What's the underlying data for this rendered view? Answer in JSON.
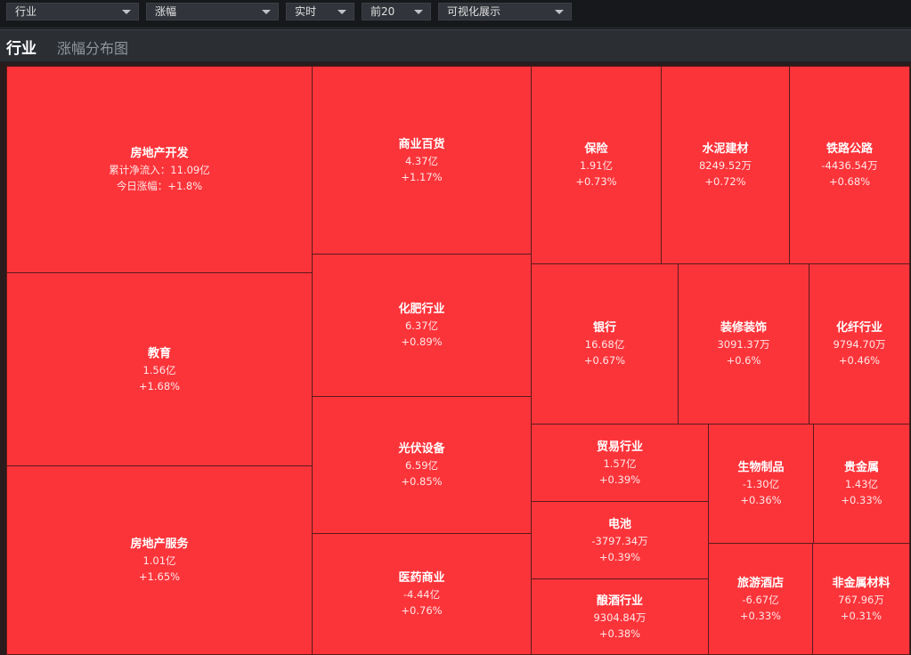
{
  "filters": [
    {
      "value": "行业"
    },
    {
      "value": "涨幅"
    },
    {
      "value": "实时"
    },
    {
      "value": "前20"
    },
    {
      "value": "可视化展示"
    }
  ],
  "header": {
    "title": "行业",
    "subtitle": "涨幅分布图"
  },
  "colors": {
    "tile": "#fb343a",
    "border": "#5b1a1c",
    "background": "#1f2226"
  },
  "tiles": [
    {
      "name": "房地产开发",
      "flow": "累计净流入：11.09亿",
      "change": "今日涨幅：+1.8%",
      "change_pct": 1.8
    },
    {
      "name": "教育",
      "flow": "1.56亿",
      "change": "+1.68%",
      "change_pct": 1.68
    },
    {
      "name": "房地产服务",
      "flow": "1.01亿",
      "change": "+1.65%",
      "change_pct": 1.65
    },
    {
      "name": "商业百货",
      "flow": "4.37亿",
      "change": "+1.17%",
      "change_pct": 1.17
    },
    {
      "name": "化肥行业",
      "flow": "6.37亿",
      "change": "+0.89%",
      "change_pct": 0.89
    },
    {
      "name": "光伏设备",
      "flow": "6.59亿",
      "change": "+0.85%",
      "change_pct": 0.85
    },
    {
      "name": "医药商业",
      "flow": "-4.44亿",
      "change": "+0.76%",
      "change_pct": 0.76
    },
    {
      "name": "保险",
      "flow": "1.91亿",
      "change": "+0.73%",
      "change_pct": 0.73
    },
    {
      "name": "水泥建材",
      "flow": "8249.52万",
      "change": "+0.72%",
      "change_pct": 0.72
    },
    {
      "name": "铁路公路",
      "flow": "-4436.54万",
      "change": "+0.68%",
      "change_pct": 0.68
    },
    {
      "name": "银行",
      "flow": "16.68亿",
      "change": "+0.67%",
      "change_pct": 0.67
    },
    {
      "name": "装修装饰",
      "flow": "3091.37万",
      "change": "+0.6%",
      "change_pct": 0.6
    },
    {
      "name": "化纤行业",
      "flow": "9794.70万",
      "change": "+0.46%",
      "change_pct": 0.46
    },
    {
      "name": "贸易行业",
      "flow": "1.57亿",
      "change": "+0.39%",
      "change_pct": 0.39
    },
    {
      "name": "电池",
      "flow": "-3797.34万",
      "change": "+0.39%",
      "change_pct": 0.39
    },
    {
      "name": "酿酒行业",
      "flow": "9304.84万",
      "change": "+0.38%",
      "change_pct": 0.38
    },
    {
      "name": "生物制品",
      "flow": "-1.30亿",
      "change": "+0.36%",
      "change_pct": 0.36
    },
    {
      "name": "贵金属",
      "flow": "1.43亿",
      "change": "+0.33%",
      "change_pct": 0.33
    },
    {
      "name": "旅游酒店",
      "flow": "-6.67亿",
      "change": "+0.33%",
      "change_pct": 0.33
    },
    {
      "name": "非金属材料",
      "flow": "767.96万",
      "change": "+0.31%",
      "change_pct": 0.31
    }
  ]
}
